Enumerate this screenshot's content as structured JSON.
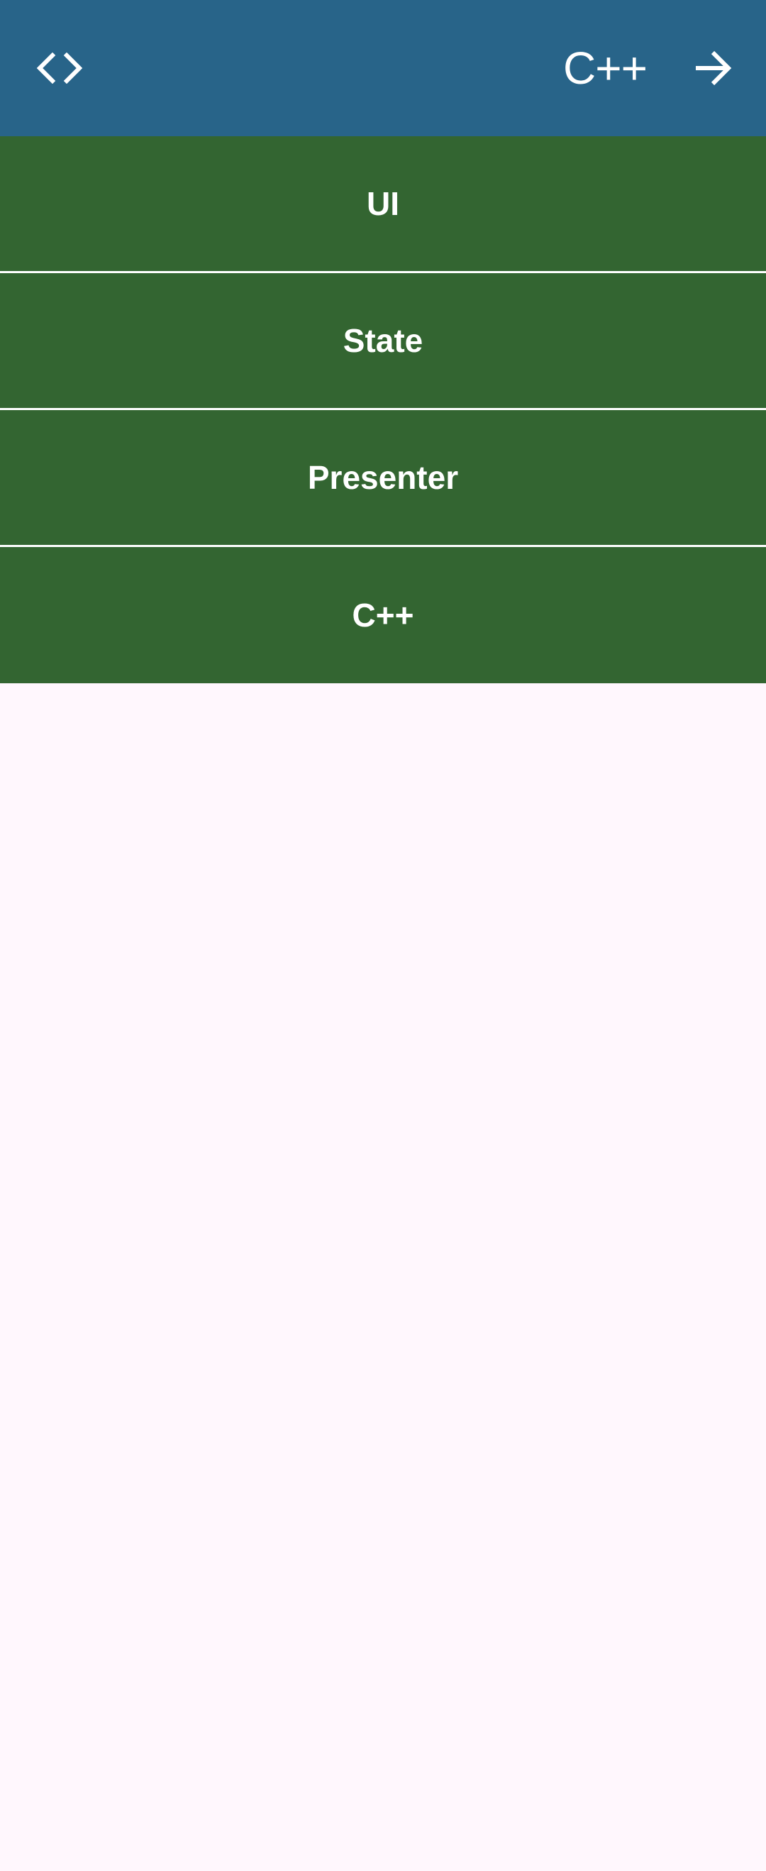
{
  "app_bar": {
    "title": "C++",
    "left_icon": "code-icon",
    "right_icon": "arrow-forward-icon",
    "background": "#286489"
  },
  "list": {
    "item_background": "#336531",
    "items": [
      {
        "label": "UI"
      },
      {
        "label": "State"
      },
      {
        "label": "Presenter"
      },
      {
        "label": "C++"
      }
    ]
  },
  "page_background": "#fff7fd"
}
